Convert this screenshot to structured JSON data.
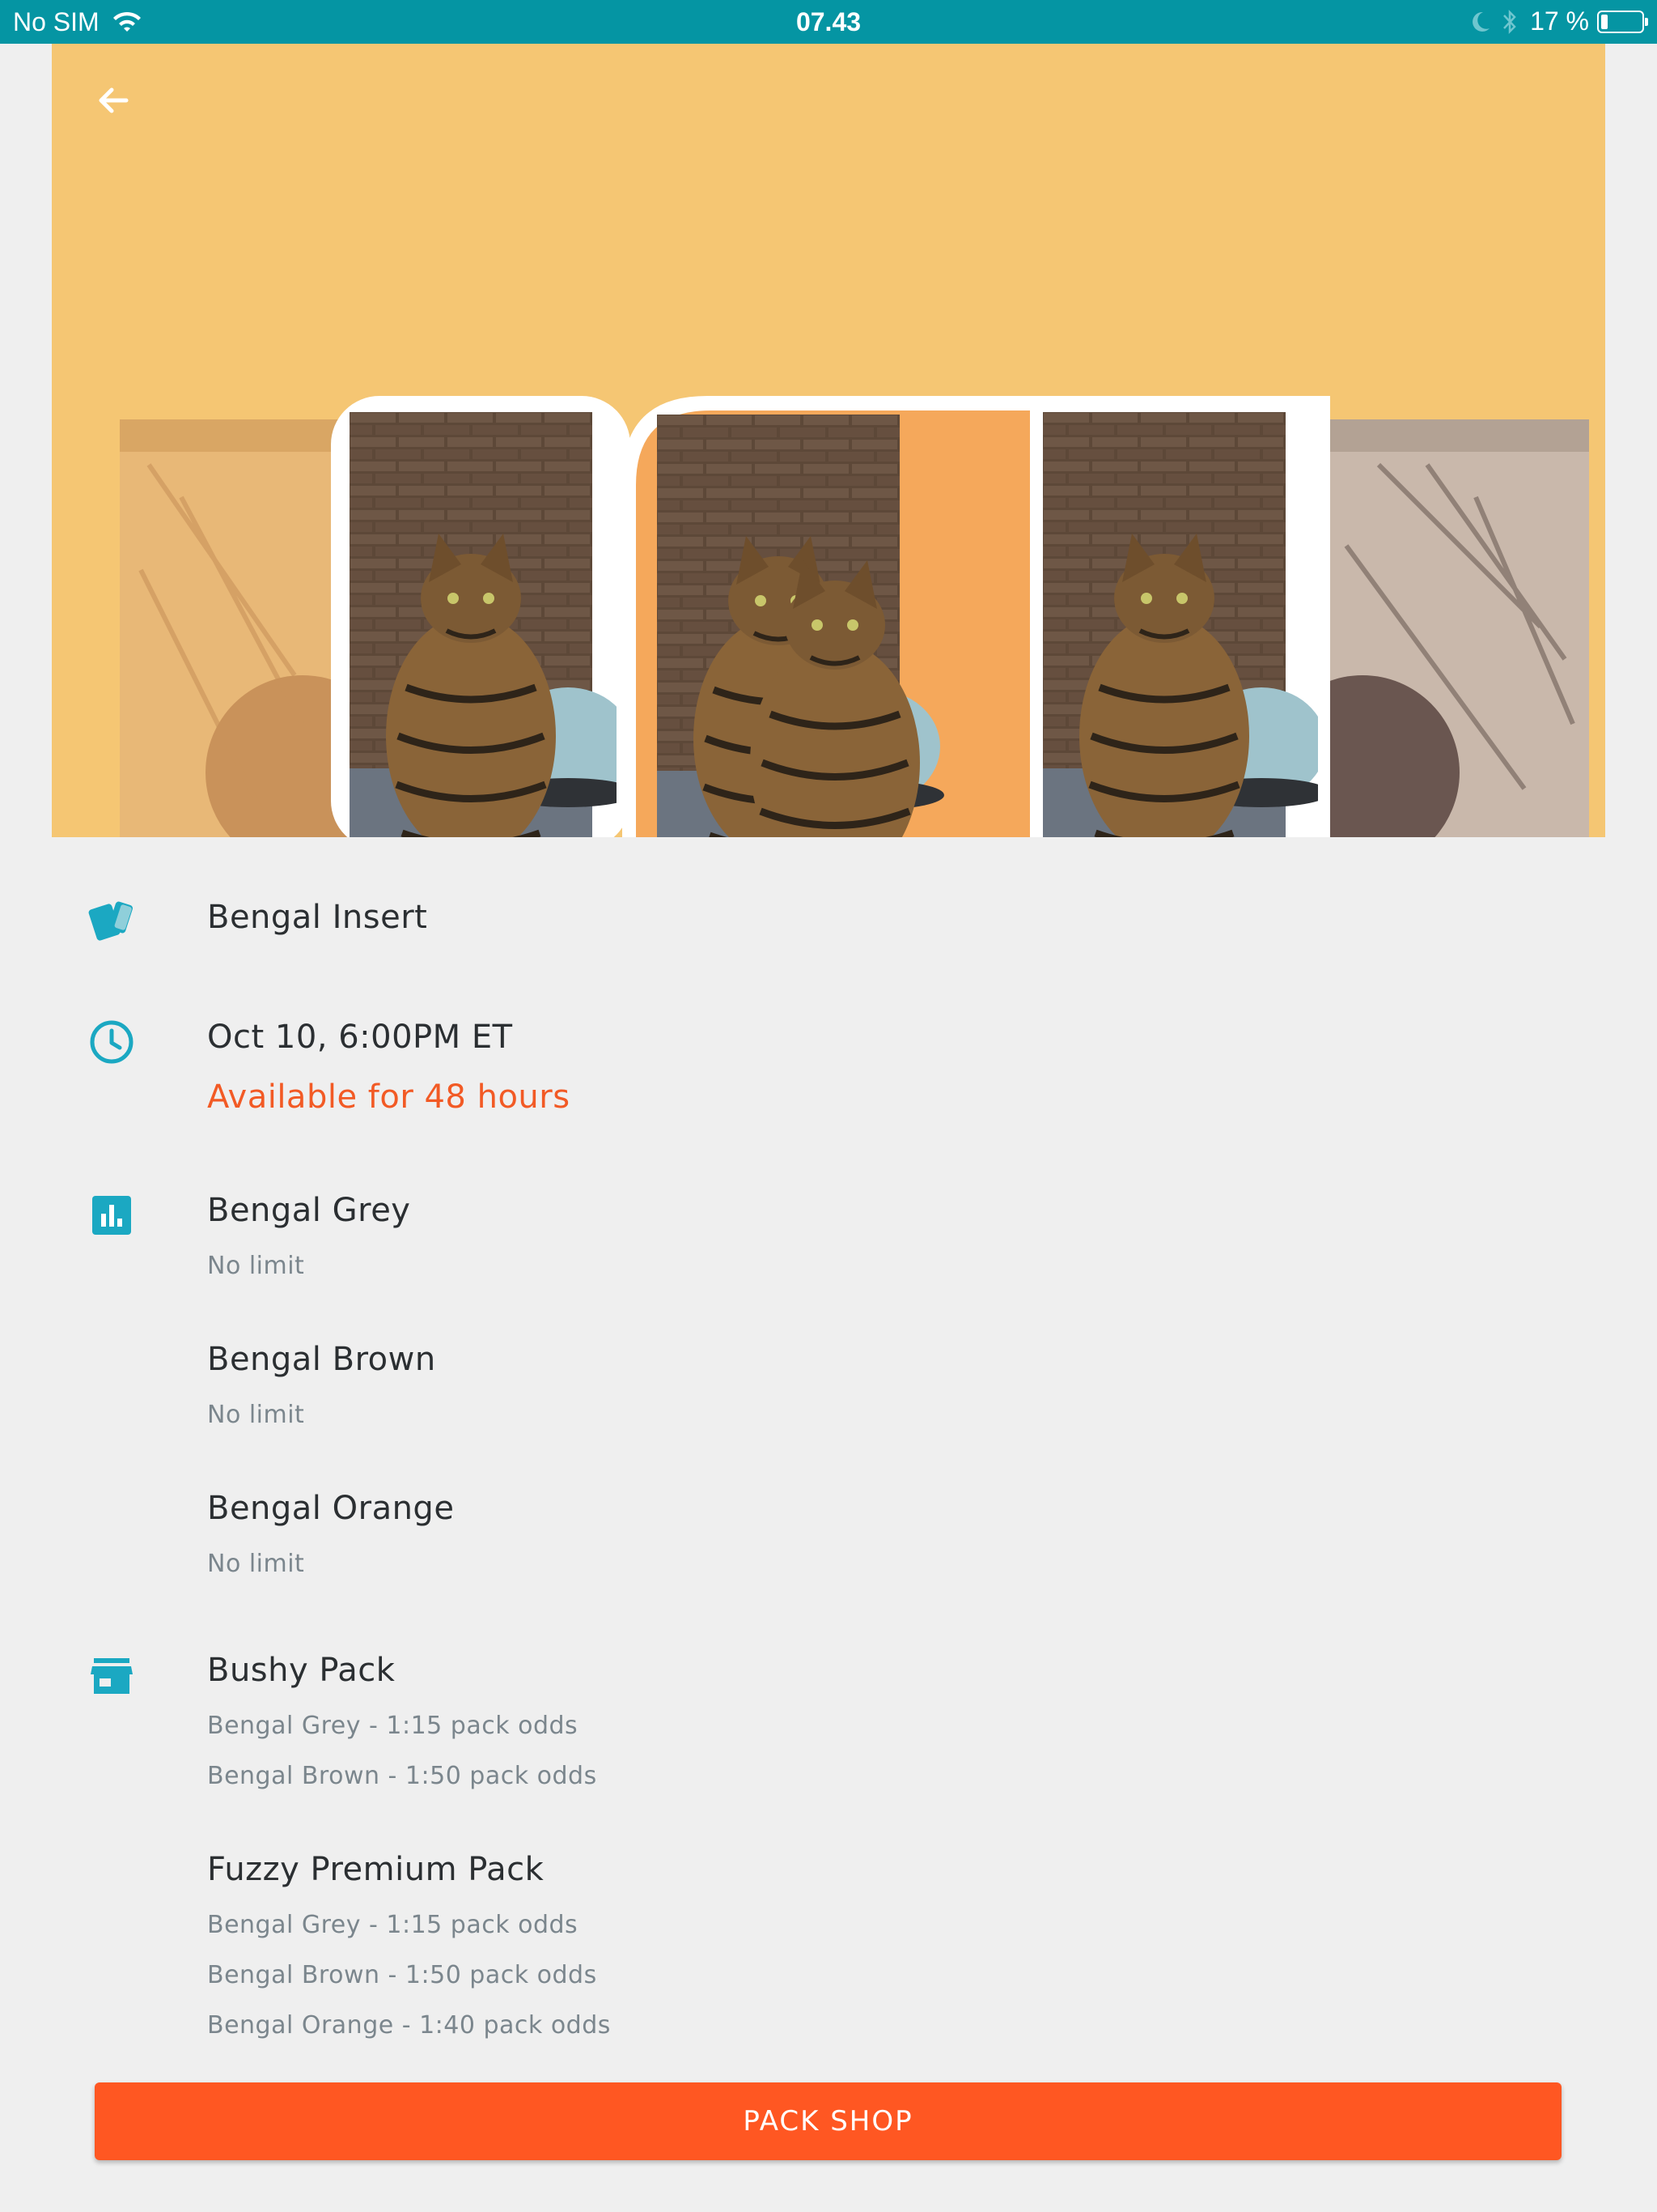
{
  "status_bar": {
    "carrier": "No SIM",
    "time": "07.43",
    "battery_text": "17 %",
    "battery_level": 0.17
  },
  "hero": {
    "background_color": "#f5c673",
    "back_icon": "arrow-left-icon"
  },
  "colors": {
    "accent_teal": "#1ba8c2",
    "accent_orange": "#f25a25",
    "button": "#ff5722",
    "status_bar": "#0595a3"
  },
  "set": {
    "icon": "cards-icon",
    "name": "Bengal Insert"
  },
  "release": {
    "icon": "clock-icon",
    "date": "Oct 10, 6:00PM ET",
    "availability": "Available for 48 hours"
  },
  "cards": {
    "icon": "bar-chart-icon",
    "items": [
      {
        "name": "Bengal Grey",
        "limit": "No limit"
      },
      {
        "name": "Bengal Brown",
        "limit": "No limit"
      },
      {
        "name": "Bengal Orange",
        "limit": "No limit"
      }
    ]
  },
  "packs": {
    "icon": "store-icon",
    "items": [
      {
        "name": "Bushy Pack",
        "odds": [
          "Bengal Grey - 1:15 pack odds",
          "Bengal Brown - 1:50 pack odds"
        ]
      },
      {
        "name": "Fuzzy Premium Pack",
        "odds": [
          "Bengal Grey - 1:15 pack odds",
          "Bengal Brown - 1:50 pack odds",
          "Bengal Orange - 1:40 pack odds"
        ]
      }
    ]
  },
  "button": {
    "label": "PACK SHOP"
  }
}
